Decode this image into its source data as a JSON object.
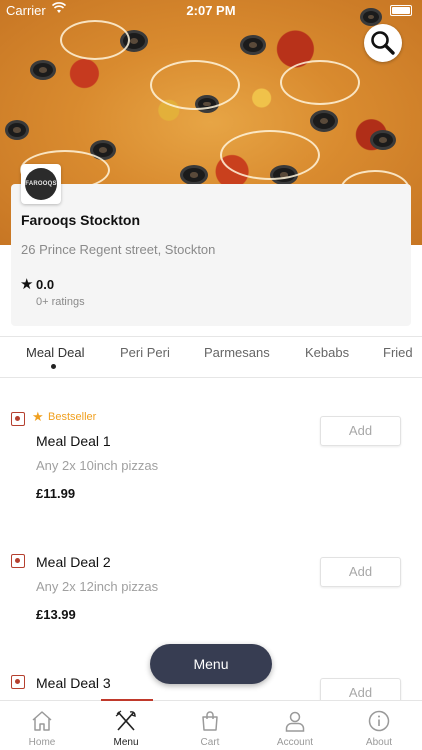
{
  "status_bar": {
    "carrier": "Carrier",
    "time": "2:07 PM"
  },
  "restaurant": {
    "logo_text": "FAROOQS",
    "name": "Farooqs Stockton",
    "address": "26 Prince Regent street, Stockton",
    "rating": "0.0",
    "ratings_count": "0+ ratings"
  },
  "tabs": [
    {
      "label": "Meal Deal",
      "active": true
    },
    {
      "label": "Peri Peri"
    },
    {
      "label": "Parmesans"
    },
    {
      "label": "Kebabs"
    },
    {
      "label": "Fried"
    }
  ],
  "items": [
    {
      "badge": "Bestseller",
      "name": "Meal Deal 1",
      "description": "Any 2x 10inch pizzas",
      "price": "£11.99",
      "button": "Add"
    },
    {
      "name": "Meal Deal 2",
      "description": "Any 2x 12inch pizzas",
      "price": "£13.99",
      "button": "Add"
    },
    {
      "name": "Meal Deal 3",
      "button": "Add"
    }
  ],
  "menu_button": "Menu",
  "bottom_nav": [
    {
      "label": "Home",
      "icon": "home-icon"
    },
    {
      "label": "Menu",
      "icon": "fork-knife-icon",
      "active": true
    },
    {
      "label": "Cart",
      "icon": "bag-icon"
    },
    {
      "label": "Account",
      "icon": "user-icon"
    },
    {
      "label": "About",
      "icon": "info-icon"
    }
  ],
  "colors": {
    "accent": "#c0392b",
    "bestseller": "#f0a020",
    "menu_button": "#373d52"
  }
}
